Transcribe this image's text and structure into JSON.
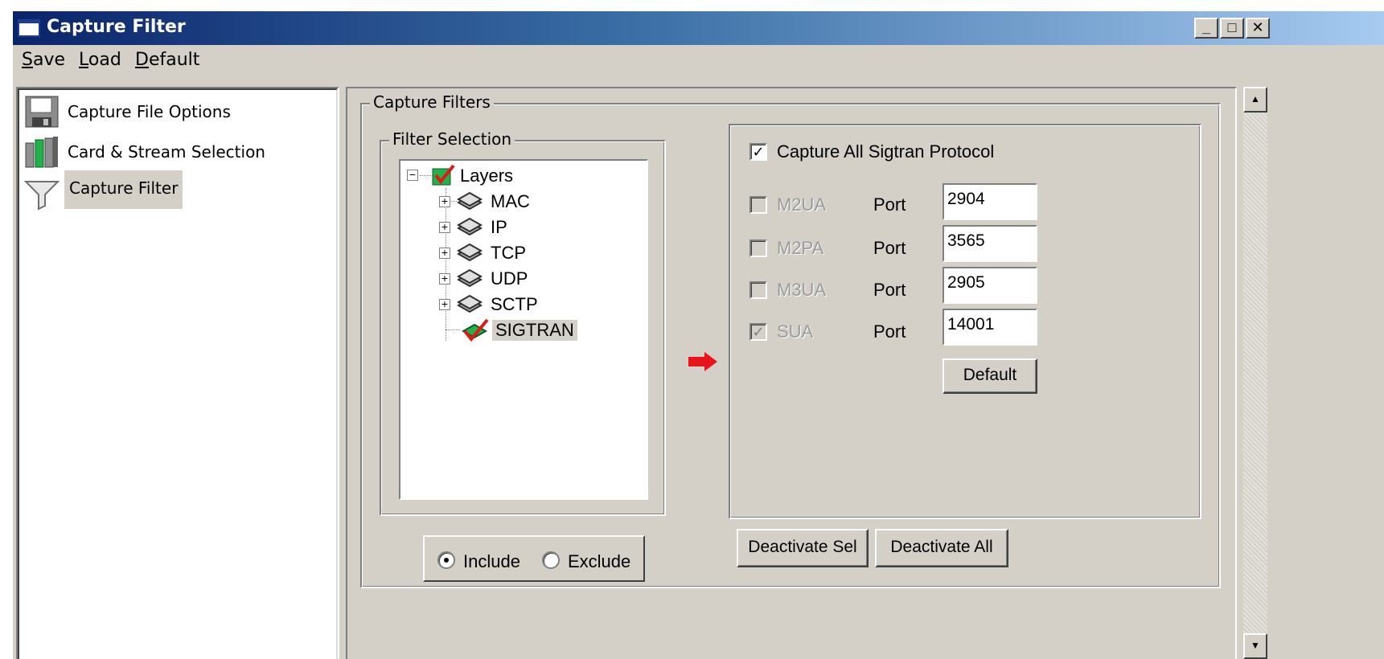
{
  "window": {
    "title": "Capture Filter",
    "controls": [
      "_",
      "□",
      "✕"
    ]
  },
  "menu": {
    "items": [
      "Save",
      "Load",
      "Default"
    ]
  },
  "sidebar": {
    "items": [
      {
        "label": "Capture File Options",
        "icon": "floppy-disk-icon",
        "selected": false
      },
      {
        "label": "Card & Stream Selection",
        "icon": "cards-icon",
        "selected": false
      },
      {
        "label": "Capture Filter",
        "icon": "funnel-icon",
        "selected": true
      }
    ]
  },
  "capture_filters": {
    "group_label": "Capture Filters",
    "filter_selection": {
      "group_label": "Filter Selection",
      "tree": {
        "root": "Layers",
        "children": [
          "MAC",
          "IP",
          "TCP",
          "UDP",
          "SCTP",
          "SIGTRAN"
        ],
        "selected": "SIGTRAN"
      },
      "mode": {
        "include_label": "Include",
        "exclude_label": "Exclude",
        "selected": "Include"
      }
    },
    "sigtran": {
      "capture_all_label": "Capture All Sigtran Protocol",
      "capture_all_checked": true,
      "port_label": "Port",
      "protocols": [
        {
          "name": "M2UA",
          "port": "2904",
          "checked": false
        },
        {
          "name": "M2PA",
          "port": "3565",
          "checked": false
        },
        {
          "name": "M3UA",
          "port": "2905",
          "checked": false
        },
        {
          "name": "SUA",
          "port": "14001",
          "checked": true
        }
      ],
      "default_button": "Default"
    },
    "deactivate_sel_button": "Deactivate Sel",
    "deactivate_all_button": "Deactivate All"
  },
  "colors": {
    "title_gradient_start": "#0a246a",
    "title_gradient_end": "#a6caf0",
    "face": "#d4d0c8",
    "arrow": "#e8141c"
  }
}
